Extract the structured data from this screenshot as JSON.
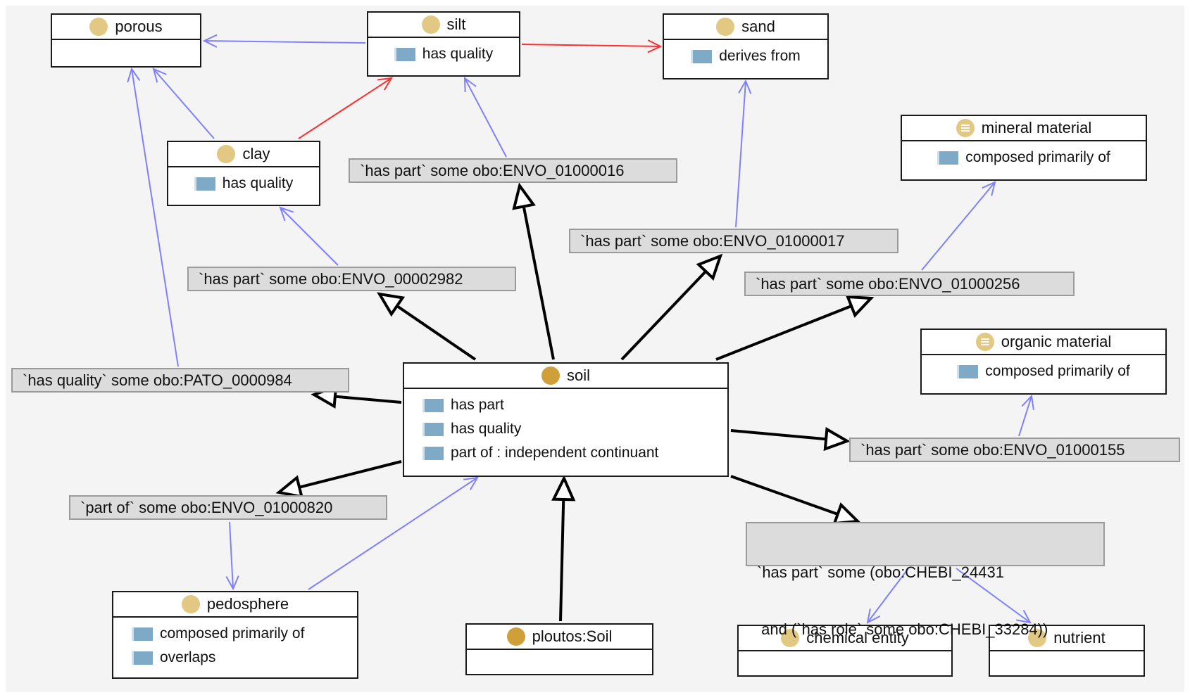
{
  "diagram": {
    "type": "ontology-class-graph",
    "colors": {
      "background": "#f4f4f4",
      "class_icon": "#e2c882",
      "class_icon_selected": "#cf9f3a",
      "property_icon": "#7eaac8",
      "subclass_edge": "#000000",
      "restriction_edge": "#8080ff",
      "quality_edge": "#ff3030",
      "label_fill": "#dcdcdc"
    },
    "nodes": {
      "porous": {
        "name": "porous",
        "icon": "class-icon",
        "properties": []
      },
      "silt": {
        "name": "silt",
        "icon": "class-icon",
        "properties": [
          "has quality"
        ]
      },
      "sand": {
        "name": "sand",
        "icon": "class-icon",
        "properties": [
          "derives from"
        ]
      },
      "clay": {
        "name": "clay",
        "icon": "class-icon",
        "properties": [
          "has quality"
        ]
      },
      "mineral_material": {
        "name": "mineral material",
        "icon": "defined-class-icon",
        "properties": [
          "composed primarily of"
        ]
      },
      "organic_material": {
        "name": "organic material",
        "icon": "defined-class-icon",
        "properties": [
          "composed primarily of"
        ]
      },
      "soil": {
        "name": "soil",
        "icon": "class-icon-selected",
        "properties": [
          "has part",
          "has quality",
          "part of : independent continuant"
        ]
      },
      "pedosphere": {
        "name": "pedosphere",
        "icon": "class-icon",
        "properties": [
          "composed primarily of",
          "overlaps"
        ]
      },
      "ploutos_soil": {
        "name": "ploutos:Soil",
        "icon": "class-icon-selected",
        "properties": []
      },
      "chemical_entity": {
        "name": "chemical entity",
        "icon": "class-icon",
        "properties": []
      },
      "nutrient": {
        "name": "nutrient",
        "icon": "class-icon",
        "properties": []
      }
    },
    "restrictions": {
      "r_016": "`has part` some obo:ENVO_01000016",
      "r_017": "`has part` some obo:ENVO_01000017",
      "r_2982": "`has part` some obo:ENVO_00002982",
      "r_256": "`has part` some obo:ENVO_01000256",
      "r_pato": "`has quality` some obo:PATO_0000984",
      "r_155": "`has part` some obo:ENVO_01000155",
      "r_820": "`part of` some obo:ENVO_01000820",
      "r_chebi_line1": "`has part` some (obo:CHEBI_24431",
      "r_chebi_line2": " and (`has role` some obo:CHEBI_33284))"
    },
    "edges": [
      {
        "from": "soil",
        "to": "r_016",
        "kind": "subclass"
      },
      {
        "from": "soil",
        "to": "r_017",
        "kind": "subclass"
      },
      {
        "from": "soil",
        "to": "r_2982",
        "kind": "subclass"
      },
      {
        "from": "soil",
        "to": "r_256",
        "kind": "subclass"
      },
      {
        "from": "soil",
        "to": "r_pato",
        "kind": "subclass"
      },
      {
        "from": "soil",
        "to": "r_155",
        "kind": "subclass"
      },
      {
        "from": "soil",
        "to": "r_820",
        "kind": "subclass"
      },
      {
        "from": "soil",
        "to": "r_chebi",
        "kind": "subclass"
      },
      {
        "from": "ploutos_soil",
        "to": "soil",
        "kind": "subclass"
      },
      {
        "from": "r_016",
        "to": "silt",
        "kind": "restriction"
      },
      {
        "from": "r_017",
        "to": "sand",
        "kind": "restriction"
      },
      {
        "from": "r_2982",
        "to": "clay",
        "kind": "restriction"
      },
      {
        "from": "r_256",
        "to": "mineral_material",
        "kind": "restriction"
      },
      {
        "from": "r_pato",
        "to": "porous",
        "kind": "restriction"
      },
      {
        "from": "r_155",
        "to": "organic_material",
        "kind": "restriction"
      },
      {
        "from": "r_820",
        "to": "pedosphere",
        "kind": "restriction"
      },
      {
        "from": "pedosphere",
        "to": "soil",
        "kind": "restriction"
      },
      {
        "from": "r_chebi",
        "to": "chemical_entity",
        "kind": "restriction"
      },
      {
        "from": "r_chebi",
        "to": "nutrient",
        "kind": "restriction"
      },
      {
        "from": "silt",
        "to": "porous",
        "kind": "restriction"
      },
      {
        "from": "clay",
        "to": "porous",
        "kind": "restriction"
      },
      {
        "from": "clay",
        "to": "silt",
        "kind": "quality"
      },
      {
        "from": "silt",
        "to": "sand",
        "kind": "quality"
      }
    ]
  }
}
